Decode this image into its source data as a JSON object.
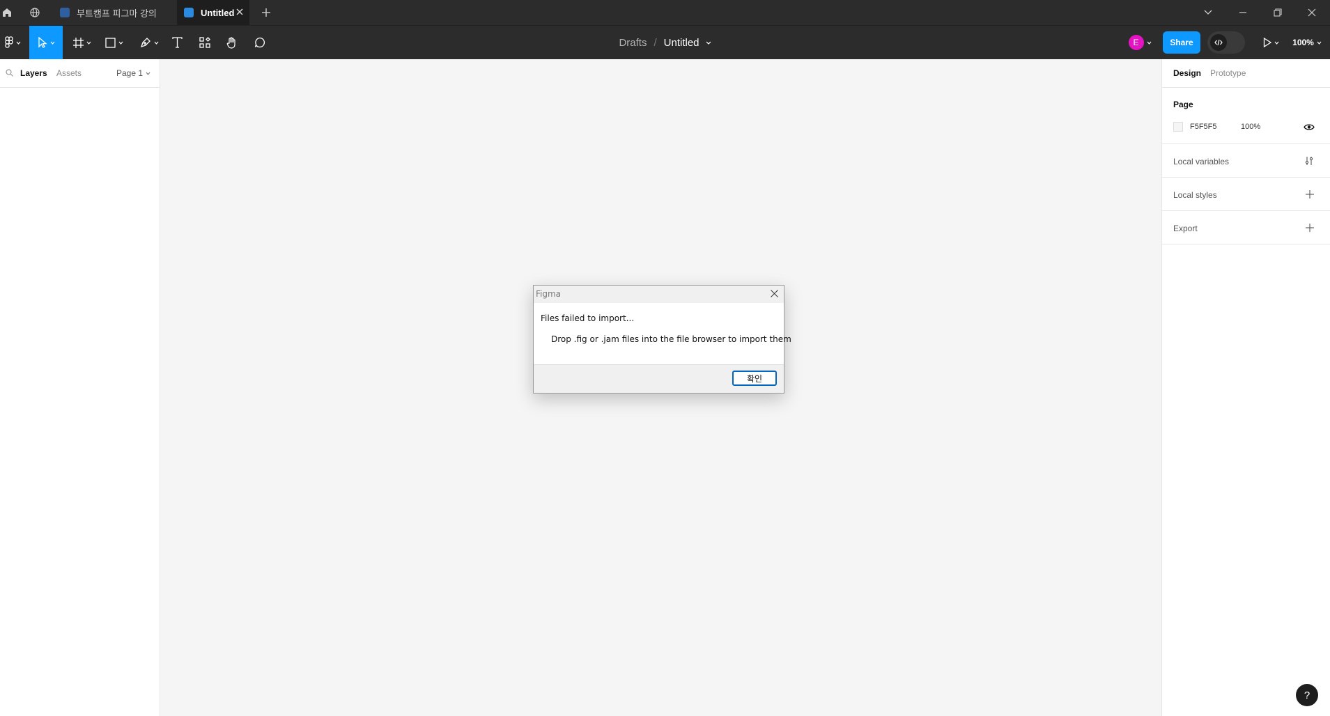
{
  "titlebar": {
    "tabs": [
      {
        "label": "부트캠프 피그마 강의",
        "active": false
      },
      {
        "label": "Untitled",
        "active": true
      }
    ]
  },
  "toolbar": {
    "breadcrumb_parent": "Drafts",
    "breadcrumb_sep": "/",
    "file_name": "Untitled",
    "avatar_initial": "E",
    "share_label": "Share",
    "zoom": "100%",
    "accent_color": "#0d99ff",
    "avatar_color": "#e514c3"
  },
  "left_panel": {
    "tab_layers": "Layers",
    "tab_assets": "Assets",
    "page_selector": "Page 1"
  },
  "right_panel": {
    "tab_design": "Design",
    "tab_prototype": "Prototype",
    "page_heading": "Page",
    "page_color_hex": "F5F5F5",
    "page_opacity": "100%",
    "local_variables": "Local variables",
    "local_styles": "Local styles",
    "export": "Export"
  },
  "dialog": {
    "title": "Figma",
    "message": "Files failed to import...",
    "detail": "Drop .fig or .jam files into the file browser to import them",
    "ok_label": "확인"
  },
  "help_label": "?"
}
